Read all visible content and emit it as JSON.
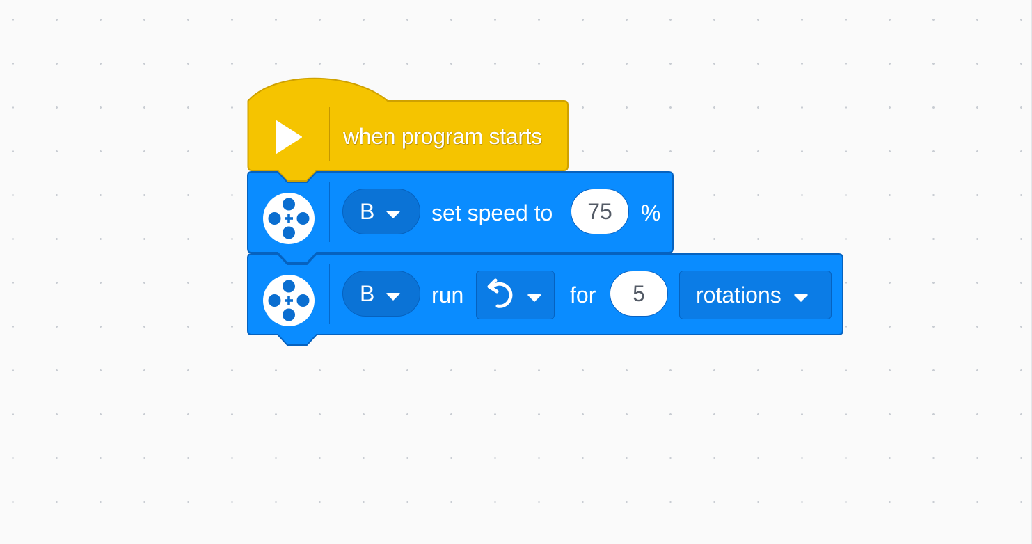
{
  "colors": {
    "workspace_bg": "#fafafa",
    "event_block": "#f5c400",
    "event_block_border": "#cfa100",
    "motor_block": "#0a8cff",
    "motor_block_border": "#0662bf",
    "input_bg": "#ffffff",
    "input_text": "#545b66"
  },
  "hat": {
    "icon": "play-triangle-icon",
    "label": "when program starts"
  },
  "set_speed": {
    "icon": "motor-icon",
    "port": "B",
    "text": "set speed to",
    "value": "75",
    "unit": "%"
  },
  "run": {
    "icon": "motor-icon",
    "port": "B",
    "text": "run",
    "direction_icon": "counterclockwise-arrow-icon",
    "for_text": "for",
    "value": "5",
    "unit": "rotations"
  }
}
